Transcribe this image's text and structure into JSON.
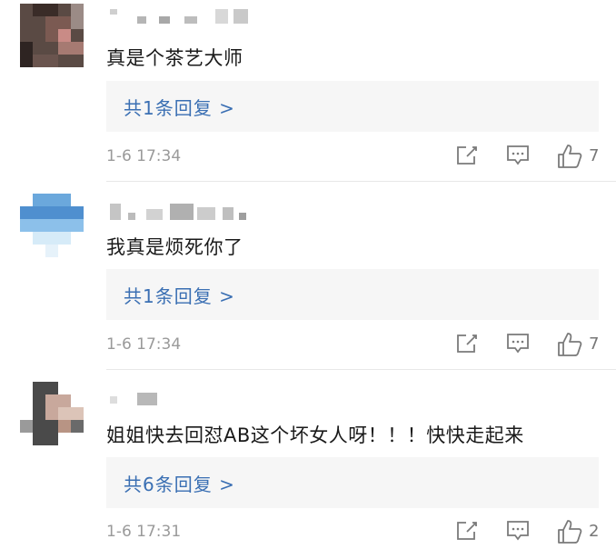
{
  "comments": [
    {
      "text": "真是个茶艺大师",
      "reply": "共1条回复 >",
      "time": "1-6 17:34",
      "likes": "7"
    },
    {
      "text": "我真是烦死你了",
      "reply": "共1条回复 >",
      "time": "1-6 17:34",
      "likes": "7"
    },
    {
      "text": "姐姐快去回怼AB这个坏女人呀！！！快快走起来",
      "reply": "共6条回复 >",
      "time": "1-6 17:31",
      "likes": "2"
    }
  ],
  "icons": {
    "share": "share-icon",
    "comment": "comment-icon",
    "like": "thumbs-up-icon"
  },
  "colors": {
    "link": "#3a6fb3",
    "reply_bg": "#f6f6f6",
    "time": "#9a9a9a"
  }
}
